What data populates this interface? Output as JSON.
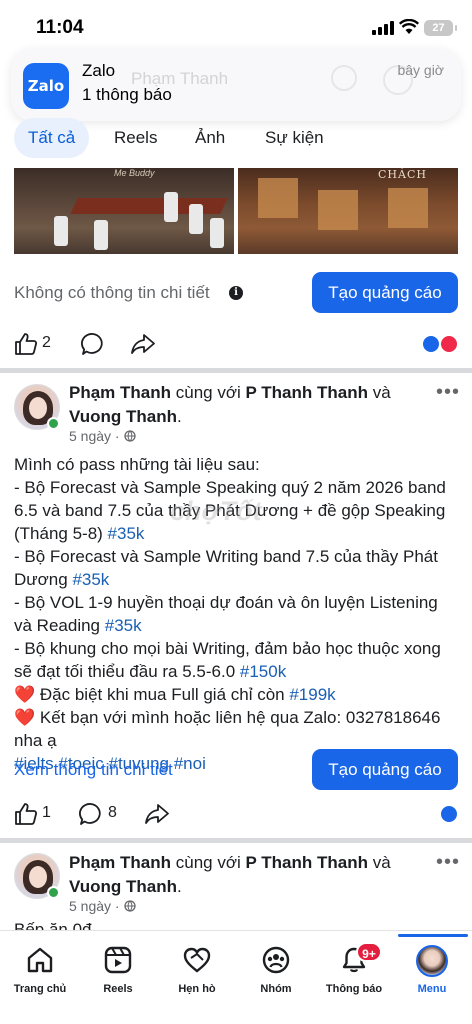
{
  "status_bar": {
    "time": "11:04",
    "battery": "27"
  },
  "notification": {
    "app_name": "Zalo",
    "logo_text": "Zalo",
    "message": "1 thông báo",
    "time": "bây giờ",
    "behind_text": "Phạm Thanh"
  },
  "tabs": [
    {
      "label": "Tất cả",
      "active": true
    },
    {
      "label": "Reels",
      "active": false
    },
    {
      "label": "Ảnh",
      "active": false
    },
    {
      "label": "Sự kiện",
      "active": false
    }
  ],
  "photos": {
    "cafe_sign": "CHÁCH",
    "mark": "Me Buddy"
  },
  "ad_row_1": {
    "info_text": "Không có thông tin chi tiết",
    "info_icon": "i",
    "button": "Tạo quảng cáo"
  },
  "actions_1": {
    "like_count": "2"
  },
  "post_1": {
    "author": "Phạm Thanh",
    "with_word": "cùng với",
    "co_author_1": "P Thanh Thanh",
    "and_word": "và",
    "co_author_2": "Vuong Thanh",
    "period": ".",
    "time": "5 ngày",
    "body_lines": [
      {
        "text": "Mình có pass những tài liệu sau:",
        "tag": ""
      },
      {
        "text": "- Bộ Forecast và Sample Speaking quý 2 năm 2026 band",
        "tag": ""
      },
      {
        "text": "6.5 và band 7.5 của thầy Phát Dương + đề gộp Speaking",
        "tag": ""
      },
      {
        "text": "(Tháng 5-8) ",
        "tag": "#35k"
      },
      {
        "text": "- Bộ Forecast và Sample Writing band 7.5 của thầy Phát",
        "tag": ""
      },
      {
        "text": "Dương ",
        "tag": "#35k"
      },
      {
        "text": "- Bộ VOL 1-9 huyền thoại dự đoán và ôn luyện Listening",
        "tag": ""
      },
      {
        "text": "và Reading ",
        "tag": "#35k"
      },
      {
        "text": "- Bộ khung cho mọi bài Writing, đảm bảo học thuộc xong",
        "tag": ""
      },
      {
        "text": "sẽ đạt tối thiểu đầu ra 5.5-6.0 ",
        "tag": "#150k"
      },
      {
        "text": "❤️ Đặc biệt khi mua Full giá chỉ còn ",
        "tag": "#199k"
      },
      {
        "text": "❤️ Kết bạn với mình hoặc liên hệ qua Zalo: 0327818646",
        "tag": ""
      },
      {
        "text": "nha ạ",
        "tag": ""
      }
    ],
    "hashtags": "#ielts #toeic #tuvung #noi",
    "watermark": "chợTốt",
    "more_link": "Xem thông tin chi tiết",
    "button": "Tạo quảng cáo",
    "like_count": "1",
    "comment_count": "8"
  },
  "post_2": {
    "author": "Phạm Thanh",
    "with_word": "cùng với",
    "co_author_1": "P Thanh Thanh",
    "and_word": "và",
    "co_author_2": "Vuong Thanh",
    "period": ".",
    "time": "5 ngày",
    "body_preview": "Bếp ăn 0đ"
  },
  "bottom_nav": [
    {
      "label": "Trang chủ",
      "icon": "home-icon"
    },
    {
      "label": "Reels",
      "icon": "reels-icon"
    },
    {
      "label": "Hẹn hò",
      "icon": "dating-heart-icon"
    },
    {
      "label": "Nhóm",
      "icon": "groups-icon"
    },
    {
      "label": "Thông báo",
      "icon": "bell-icon",
      "badge": "9+"
    },
    {
      "label": "Menu",
      "icon": "menu-avatar-icon",
      "active": true
    }
  ],
  "colors": {
    "accent": "#1a66e8",
    "tag": "#1a5fb4",
    "badge": "#e41e3f",
    "online": "#31a24c"
  }
}
